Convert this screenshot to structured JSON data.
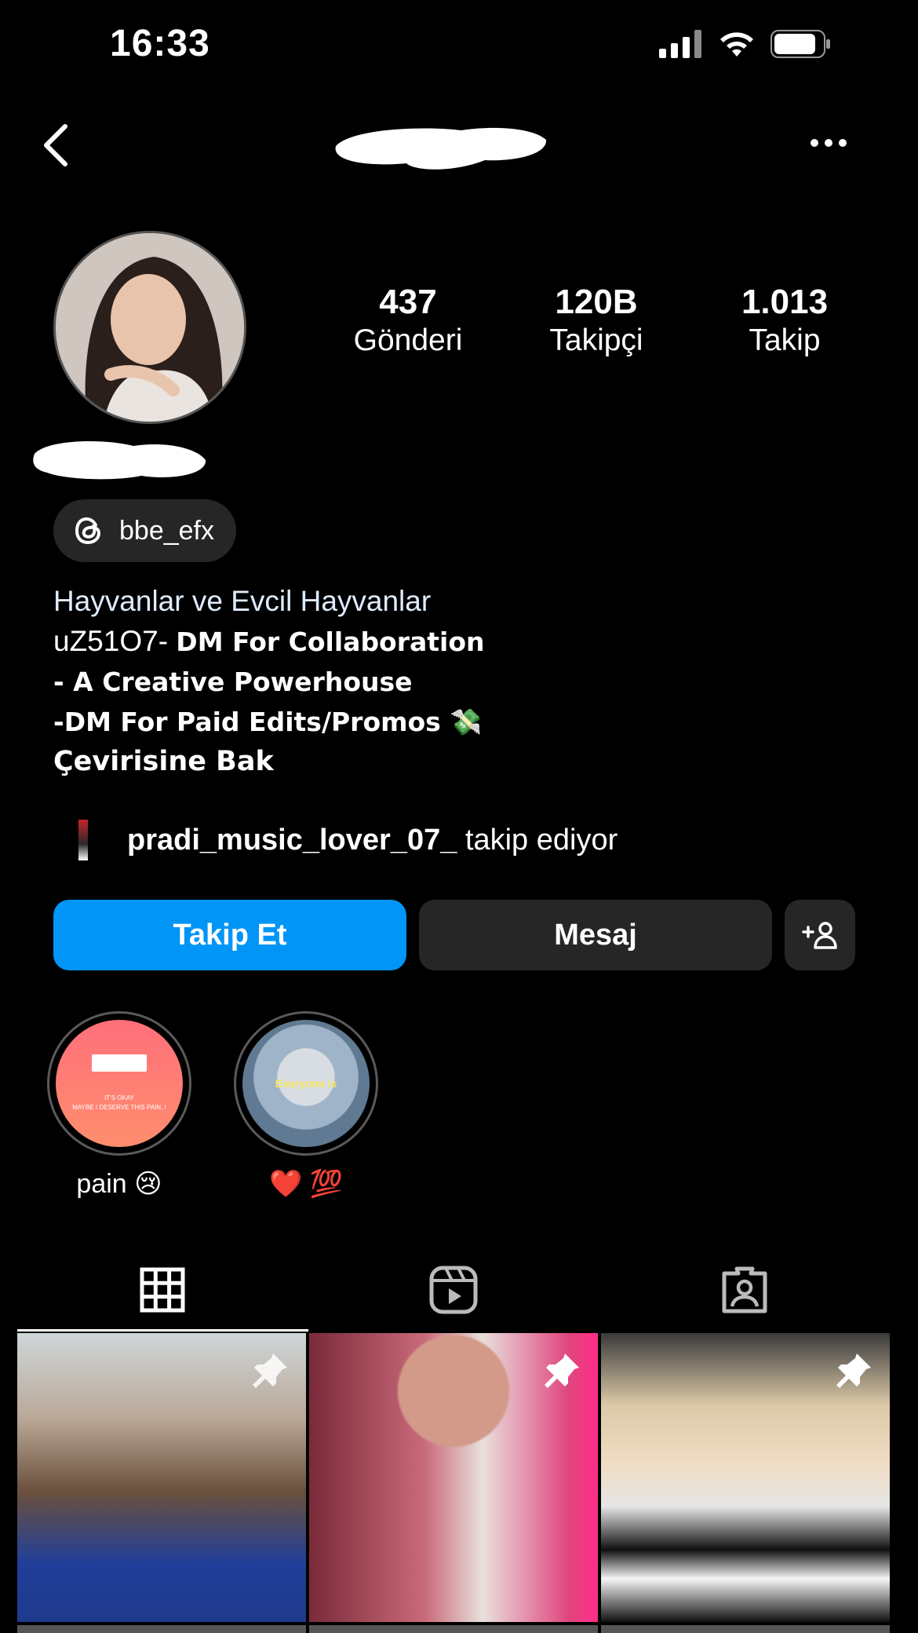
{
  "status_bar": {
    "time": "16:33"
  },
  "profile": {
    "stats": [
      {
        "value": "437",
        "label": "Gönderi"
      },
      {
        "value": "120B",
        "label": "Takipçi"
      },
      {
        "value": "1.013",
        "label": "Takip"
      }
    ],
    "threads_handle": "bbe_efx",
    "bio": {
      "category": "Hayvanlar ve Evcil Hayvanlar",
      "line1_prefix": "uZ51O7- ",
      "line1_bold": "DM For Collaboration",
      "line2": "- A Creative Powerhouse",
      "line3": "-DM For Paid Edits/Promos 💸",
      "translate": "Çevirisine Bak"
    },
    "followed_by": {
      "username": "pradi_music_lover_07_",
      "suffix": " takip ediyor"
    }
  },
  "actions": {
    "follow_label": "Takip Et",
    "message_label": "Mesaj"
  },
  "highlights": [
    {
      "label": "pain 😢",
      "tiny_text": "IT'S OKAY\nMAYBE I DESERVE THIS PAIN..!"
    },
    {
      "label": "❤️ 💯",
      "caption": "Everyone is"
    }
  ],
  "tabs": [
    "grid-icon",
    "reels-icon",
    "tagged-icon"
  ],
  "colors": {
    "accent": "#0095f6",
    "button_dark": "#262626",
    "background": "#000000"
  }
}
